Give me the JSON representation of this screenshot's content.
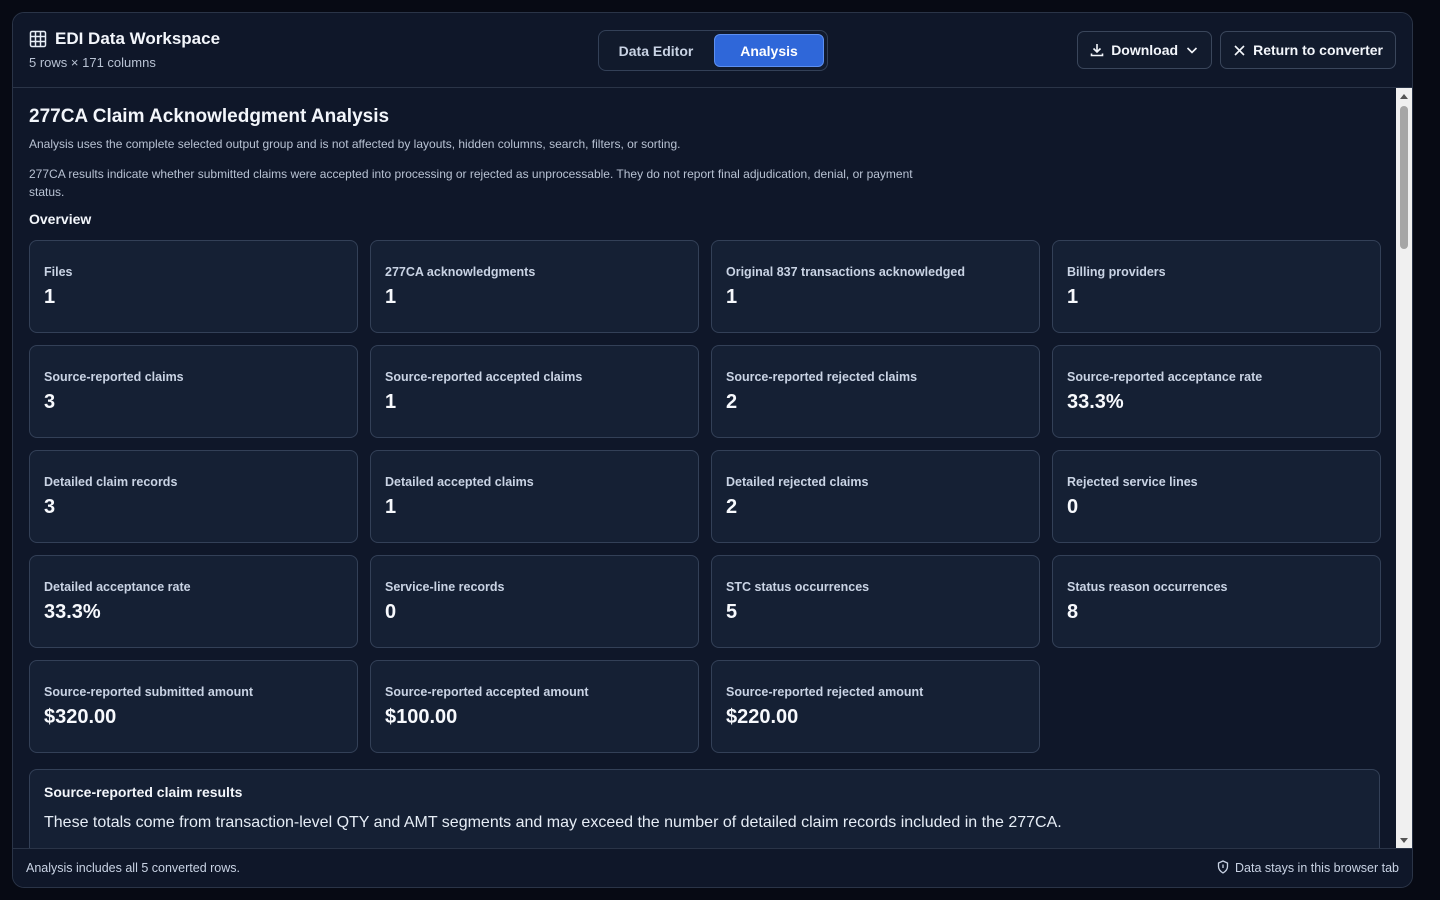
{
  "header": {
    "title": "EDI Data Workspace",
    "subtitle": "5 rows × 171 columns",
    "tabs": [
      "Data Editor",
      "Analysis"
    ],
    "active_tab": "Analysis",
    "download_label": "Download",
    "return_label": "Return to converter"
  },
  "page": {
    "title": "277CA Claim Acknowledgment Analysis",
    "meta": "Analysis uses the complete selected output group and is not affected by layouts, hidden columns, search, filters, or sorting.",
    "note": "277CA results indicate whether submitted claims were accepted into processing or rejected as unprocessable. They do not report final adjudication, denial, or payment status.",
    "overview_label": "Overview"
  },
  "cards": [
    {
      "label": "Files",
      "value": "1"
    },
    {
      "label": "277CA acknowledgments",
      "value": "1"
    },
    {
      "label": "Original 837 transactions acknowledged",
      "value": "1"
    },
    {
      "label": "Billing providers",
      "value": "1"
    },
    {
      "label": "Source-reported claims",
      "value": "3"
    },
    {
      "label": "Source-reported accepted claims",
      "value": "1"
    },
    {
      "label": "Source-reported rejected claims",
      "value": "2"
    },
    {
      "label": "Source-reported acceptance rate",
      "value": "33.3%"
    },
    {
      "label": "Detailed claim records",
      "value": "3"
    },
    {
      "label": "Detailed accepted claims",
      "value": "1"
    },
    {
      "label": "Detailed rejected claims",
      "value": "2"
    },
    {
      "label": "Rejected service lines",
      "value": "0"
    },
    {
      "label": "Detailed acceptance rate",
      "value": "33.3%"
    },
    {
      "label": "Service-line records",
      "value": "0"
    },
    {
      "label": "STC status occurrences",
      "value": "5"
    },
    {
      "label": "Status reason occurrences",
      "value": "8"
    },
    {
      "label": "Source-reported submitted amount",
      "value": "$320.00"
    },
    {
      "label": "Source-reported accepted amount",
      "value": "$100.00"
    },
    {
      "label": "Source-reported rejected amount",
      "value": "$220.00"
    }
  ],
  "results": {
    "title": "Source-reported claim results",
    "description": "These totals come from transaction-level QTY and AMT segments and may exceed the number of detailed claim records included in the 277CA."
  },
  "footer": {
    "left": "Analysis includes all 5 converted rows.",
    "right": "Data stays in this browser tab"
  },
  "colors": {
    "background": "#0f1729",
    "card": "#152034",
    "accent": "#2f67d9"
  },
  "icons": [
    "grid-icon",
    "download-icon",
    "chevron-down-icon",
    "close-icon",
    "shield-icon"
  ]
}
